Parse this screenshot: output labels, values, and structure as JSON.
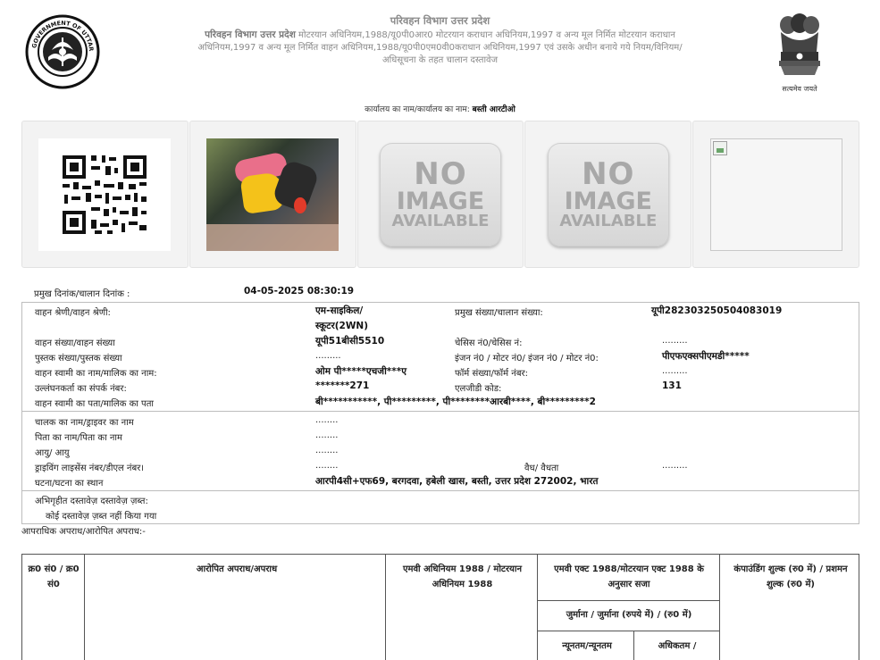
{
  "header": {
    "title": "परिवहन विभाग उत्तर प्रदेश",
    "bold_prefix": "परिवहन विभाग उत्तर प्रदेश",
    "description": "मोटरयान अधिनियम,1988/यू0पी0आर0 मोटरयान कराधान अधिनियम,1997 व अन्य मूल निर्मित मोटरयान कराधान अधिनियम,1997 व अन्य मूल निर्मित वाहन अधिनियम,1988/यू0पी0एम0वी0कराधान अधिनियम,1997 एवं उसके अधीन बनाये गये नियम/विनियम/अधिसूचना के तहत चालान दस्तावेज",
    "seal_text": "GOVERNMENT OF UTTAR PRADESH",
    "emblem_motto": "सत्यमेव जयते"
  },
  "office": {
    "label": "कार्यालय का नाम/कार्यालय का नाम:",
    "value": "बस्ती आरटीओ"
  },
  "photos": {
    "noimage": [
      "NO",
      "IMAGE",
      "AVAILABLE"
    ]
  },
  "challan": {
    "date_label": "प्रमुख दिनांक/चालान दिनांक :",
    "date_value": "04-05-2025 08:30:19",
    "vehicle_class_label": "वाहन श्रेणी/वाहन श्रेणी:",
    "vehicle_class_value_1": "एम-साइकिल/",
    "vehicle_class_value_2": "स्कूटर(2WN)",
    "challan_no_label": "प्रमुख संख्या/चालान संख्या:",
    "challan_no_value": "यूपी282303250504083019",
    "vehicle_no_label": "वाहन संख्या/वाहन संख्या",
    "vehicle_no_value": "यूपी51बीसी5510",
    "chassis_label": "चेसिस नं0/चेसिस नं:",
    "chassis_value": ".........",
    "book_no_label": "पुस्तक संख्या/पुस्तक संख्या",
    "book_no_value": ".........",
    "engine_label": "इंजन नं0 / मोटर नं0/ इंजन नं0 / मोटर नं0:",
    "engine_value": "पीएफएक्सपीएमडी*****",
    "owner_label": "वाहन स्वामी का नाम/मालिक का नाम:",
    "owner_value": "ओम पी*****एचजी***ए",
    "form_no_label": "फॉर्म संख्या/फॉर्म नंबर:",
    "form_no_value": ".........",
    "contact_label": "उल्लंघनकर्ता का संपर्क नंबर:",
    "contact_value": "*******271",
    "lgd_label": "एलजीडी कोड:",
    "lgd_value": "131",
    "owner_address_label": "वाहन स्वामी का पता/मालिक का पता",
    "owner_address_value": "बी***********, पी*********, पी********आरबी****, बी*********2",
    "driver_name_label": "चालक का नाम/ड्राइवर का नाम",
    "driver_name_value": "........",
    "father_name_label": "पिता का नाम/पिता का नाम",
    "father_name_value": "........",
    "age_label": "आयु/ आयु",
    "age_value": "........",
    "dl_label": "ड्राइविंग लाइसेंस नंबर/डीएल नंबर।",
    "dl_value": "........",
    "validity_label": "वैध/ वैधता",
    "validity_value": ".........",
    "place_label": "घटना/घटना का स्थान",
    "place_value": "आरपी4सी+एफ69, बरगदवा, हबेली खास, बस्ती, उत्तर प्रदेश 272002, भारत",
    "seized_label": "अभिगृहीत दस्तावेज़ दस्तावेज़ ज़ब्त:",
    "seized_value": "कोई दस्तावेज़ ज़ब्त नहीं किया गया"
  },
  "offence": {
    "section_label": "आपराधिक अपराध/आरोपित अपराध:-",
    "col_sno": "क्र0 सं0 / क्र0 सं0",
    "col_offence": "आरोपित अपराध/अपराध",
    "col_act": "एमवी अधिनियम 1988 / मोटरयान अधिनियम 1988",
    "col_penalty": "एमवी एक्ट 1988/मोटरयान एक्ट 1988 के अनुसार सजा",
    "col_fine": "जुर्माना / जुर्माना (रुपये में) / (रु0 में)",
    "col_min": "न्यूनतम/न्यूनतम",
    "col_max": "अधिकतम /",
    "col_compounding": "कंपाउंडिंग शुल्क (रु0 में) / प्रशमन शुल्क (रु0 में)"
  }
}
